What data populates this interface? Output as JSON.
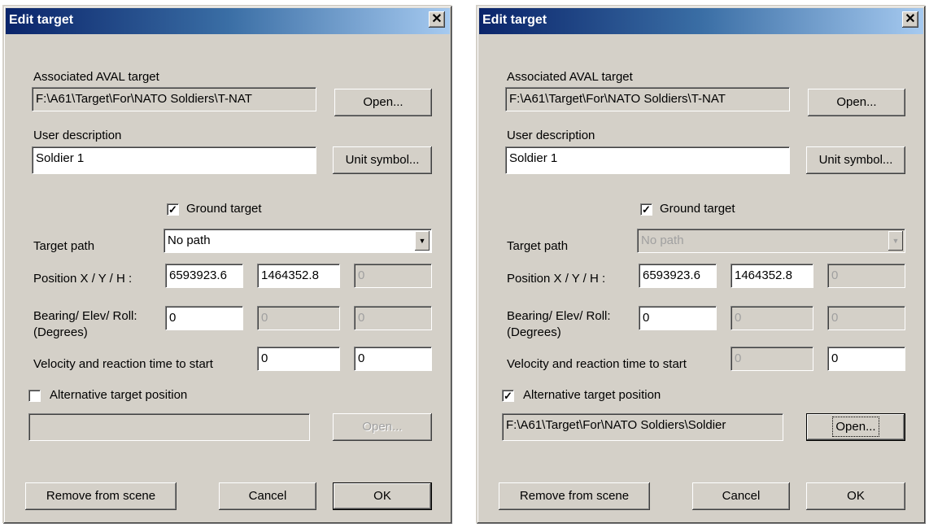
{
  "dialogs": [
    {
      "title": "Edit target",
      "close_glyph": "✕",
      "associated_label": "Associated AVAL target",
      "associated_path": "F:\\A61\\Target\\For\\NATO Soldiers\\T-NAT",
      "open_label": "Open...",
      "user_desc_label": "User description",
      "user_desc_value": "Soldier 1",
      "unit_symbol_label": "Unit symbol...",
      "ground_target_label": "Ground target",
      "ground_target_checked": "✓",
      "target_path_label": "Target path",
      "target_path_value": "No path",
      "position_label": "Position X / Y / H :",
      "pos_x": "6593923.6",
      "pos_y": "1464352.8",
      "pos_h": "0",
      "bearing_label": "Bearing/ Elev/ Roll:",
      "degrees_label": "(Degrees)",
      "bearing": "0",
      "elev": "0",
      "roll": "0",
      "velocity_label": "Velocity and reaction time to start",
      "velocity": "0",
      "reaction": "0",
      "alt_label": "Alternative target position",
      "alt_checked": "",
      "alt_path": "",
      "alt_open_label": "Open...",
      "remove_label": "Remove from scene",
      "cancel_label": "Cancel",
      "ok_label": "OK"
    },
    {
      "title": "Edit target",
      "close_glyph": "✕",
      "associated_label": "Associated AVAL target",
      "associated_path": "F:\\A61\\Target\\For\\NATO Soldiers\\T-NAT",
      "open_label": "Open...",
      "user_desc_label": "User description",
      "user_desc_value": "Soldier 1",
      "unit_symbol_label": "Unit symbol...",
      "ground_target_label": "Ground target",
      "ground_target_checked": "✓",
      "target_path_label": "Target path",
      "target_path_value": "No path",
      "position_label": "Position X / Y / H :",
      "pos_x": "6593923.6",
      "pos_y": "1464352.8",
      "pos_h": "0",
      "bearing_label": "Bearing/ Elev/ Roll:",
      "degrees_label": "(Degrees)",
      "bearing": "0",
      "elev": "0",
      "roll": "0",
      "velocity_label": "Velocity and reaction time to start",
      "velocity": "0",
      "reaction": "0",
      "alt_label": "Alternative target position",
      "alt_checked": "✓",
      "alt_path": "F:\\A61\\Target\\For\\NATO Soldiers\\Soldier",
      "alt_open_label": "Open...",
      "remove_label": "Remove from scene",
      "cancel_label": "Cancel",
      "ok_label": "OK"
    }
  ]
}
